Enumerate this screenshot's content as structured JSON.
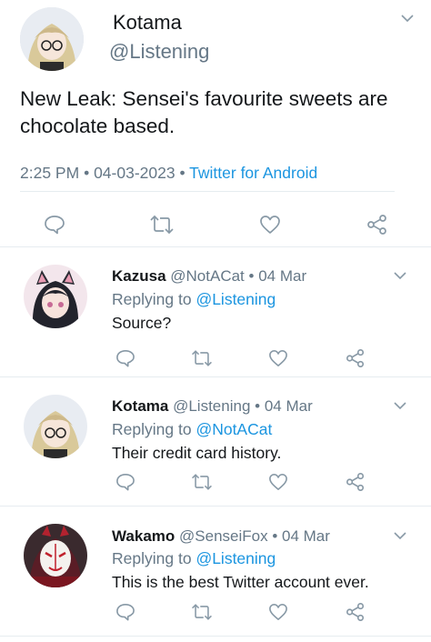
{
  "main_tweet": {
    "name": "Kotama",
    "handle": "@Listening",
    "text_line1": "New Leak: Sensei's favourite sweets are",
    "text_line2": "chocolate based.",
    "time": "2:25 PM",
    "dot1": "•",
    "date": "04-03-2023",
    "dot2": "•",
    "client": "Twitter for Android"
  },
  "replies": [
    {
      "name": "Kazusa",
      "handle": "@NotACat",
      "dot": "•",
      "date": "04 Mar",
      "replying_prefix": "Replying to",
      "replying_to": "@Listening",
      "text": "Source?"
    },
    {
      "name": "Kotama",
      "handle": "@Listening",
      "dot": "•",
      "date": "04 Mar",
      "replying_prefix": "Replying to",
      "replying_to": "@NotACat",
      "text": "Their credit card history."
    },
    {
      "name": "Wakamo",
      "handle": "@SenseiFox",
      "dot": "•",
      "date": "04 Mar",
      "replying_prefix": "Replying to",
      "replying_to": "@Listening",
      "text": "This is the best Twitter account ever."
    }
  ],
  "icons": [
    "chevron-down-icon",
    "reply-icon",
    "retweet-icon",
    "like-icon",
    "share-icon"
  ],
  "colors": {
    "link": "#1b95e0",
    "muted": "#657786",
    "text": "#14171a",
    "divider": "#e6ecf0"
  }
}
